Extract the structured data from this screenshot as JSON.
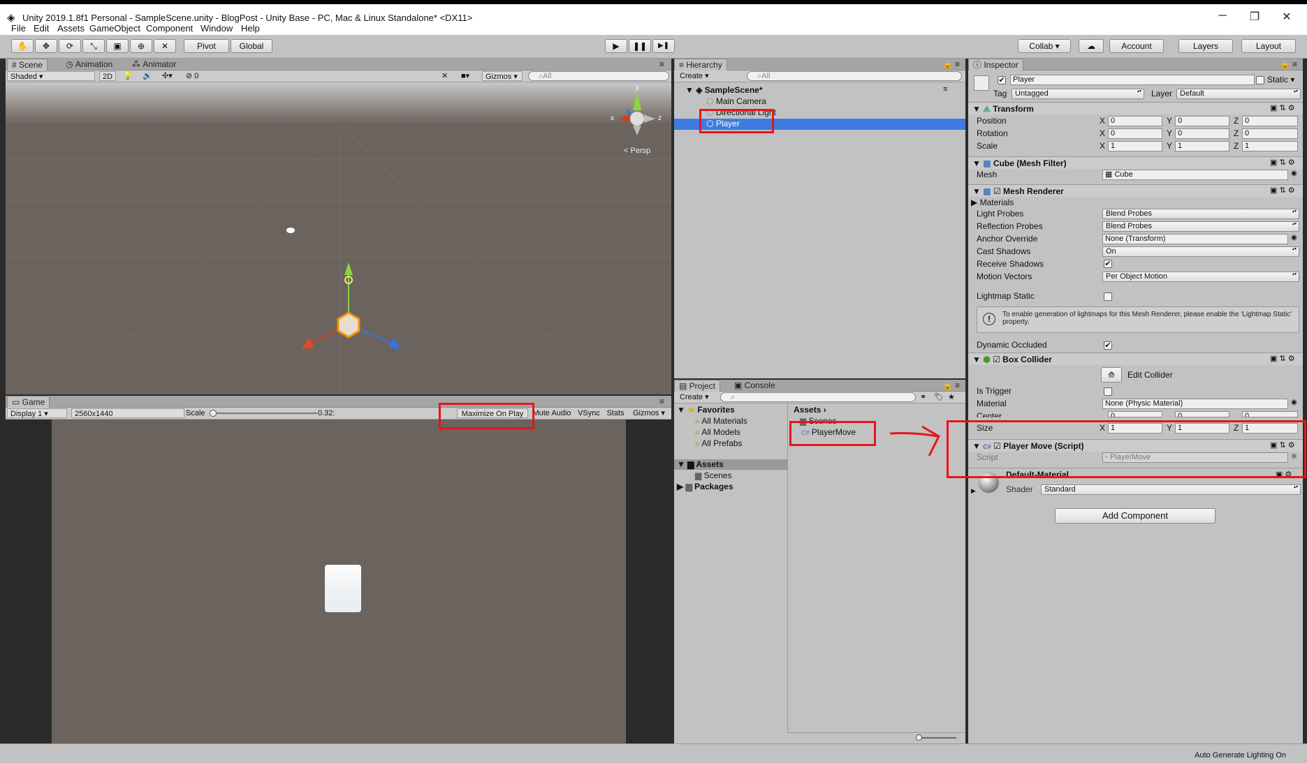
{
  "window": {
    "title": "Unity 2019.1.8f1 Personal - SampleScene.unity - BlogPost - Unity Base - PC, Mac & Linux Standalone* <DX11>",
    "minimize": "─",
    "maximize": "❐",
    "close": "✕"
  },
  "menu": [
    "File",
    "Edit",
    "Assets",
    "GameObject",
    "Component",
    "Window",
    "Help"
  ],
  "toolbar": {
    "pivot": "Pivot",
    "global": "Global",
    "play": "▶",
    "pause": "❚❚",
    "step": "▶❚",
    "collab": "Collab ▾",
    "account": "Account",
    "layers": "Layers",
    "layout": "Layout"
  },
  "scene": {
    "tabs": [
      "Scene",
      "Animation",
      "Animator"
    ],
    "shading": "Shaded",
    "mode2d": "2D",
    "fx_count": "0",
    "gizmos": "Gizmos",
    "search_placeholder": "All",
    "persp": "Persp",
    "axis_x": "x",
    "axis_y": "y",
    "axis_z": "z"
  },
  "game": {
    "tab": "Game",
    "display": "Display 1",
    "resolution": "2560x1440",
    "scale_label": "Scale",
    "scale_value": "0.32:",
    "maximize": "Maximize On Play",
    "mute": "Mute Audio",
    "vsync": "VSync",
    "stats": "Stats",
    "gizmos": "Gizmos"
  },
  "hierarchy": {
    "tab": "Hierarchy",
    "create": "Create",
    "search_placeholder": "All",
    "scene": "SampleScene*",
    "items": [
      "Main Camera",
      "Directional Light",
      "Player"
    ]
  },
  "project": {
    "tabs": [
      "Project",
      "Console"
    ],
    "create": "Create",
    "favorites": "Favorites",
    "fav_items": [
      "All Materials",
      "All Models",
      "All Prefabs"
    ],
    "assets": "Assets",
    "asset_children": [
      "Scenes"
    ],
    "packages": "Packages",
    "breadcrumb": "Assets",
    "files": [
      "Scenes",
      "PlayerMove"
    ]
  },
  "inspector": {
    "tab": "Inspector",
    "name": "Player",
    "static": "Static",
    "tag_label": "Tag",
    "tag": "Untagged",
    "layer_label": "Layer",
    "layer": "Default",
    "transform": {
      "title": "Transform",
      "rows": [
        {
          "label": "Position",
          "x": "0",
          "y": "0",
          "z": "0"
        },
        {
          "label": "Rotation",
          "x": "0",
          "y": "0",
          "z": "0"
        },
        {
          "label": "Scale",
          "x": "1",
          "y": "1",
          "z": "1"
        }
      ]
    },
    "mesh_filter": {
      "title": "Cube (Mesh Filter)",
      "mesh_label": "Mesh",
      "mesh": "Cube"
    },
    "mesh_renderer": {
      "title": "Mesh Renderer",
      "materials": "Materials",
      "light_probes_label": "Light Probes",
      "light_probes": "Blend Probes",
      "reflection_label": "Reflection Probes",
      "reflection": "Blend Probes",
      "anchor_label": "Anchor Override",
      "anchor": "None (Transform)",
      "cast_label": "Cast Shadows",
      "cast": "On",
      "receive_label": "Receive Shadows",
      "motion_label": "Motion Vectors",
      "motion": "Per Object Motion",
      "lightmap_label": "Lightmap Static",
      "info": "To enable generation of lightmaps for this Mesh Renderer, please enable the 'Lightmap Static' property.",
      "occluded_label": "Dynamic Occluded"
    },
    "box_collider": {
      "title": "Box Collider",
      "edit": "Edit Collider",
      "trigger_label": "Is Trigger",
      "material_label": "Material",
      "material": "None (Physic Material)",
      "center_label": "Center",
      "center": {
        "x": "0",
        "y": "0",
        "z": "0"
      },
      "size_label": "Size",
      "size": {
        "x": "1",
        "y": "1",
        "z": "1"
      }
    },
    "script": {
      "title": "Player Move (Script)",
      "script_label": "Script",
      "script": "PlayerMove"
    },
    "material": {
      "title": "Default-Material",
      "shader_label": "Shader",
      "shader": "Standard"
    },
    "add_component": "Add Component"
  },
  "status": {
    "text": "Auto Generate Lighting On"
  },
  "colors": {
    "selection": "#3d7be0",
    "annotation": "#e8141c",
    "scene_bg": "#6b635e"
  }
}
